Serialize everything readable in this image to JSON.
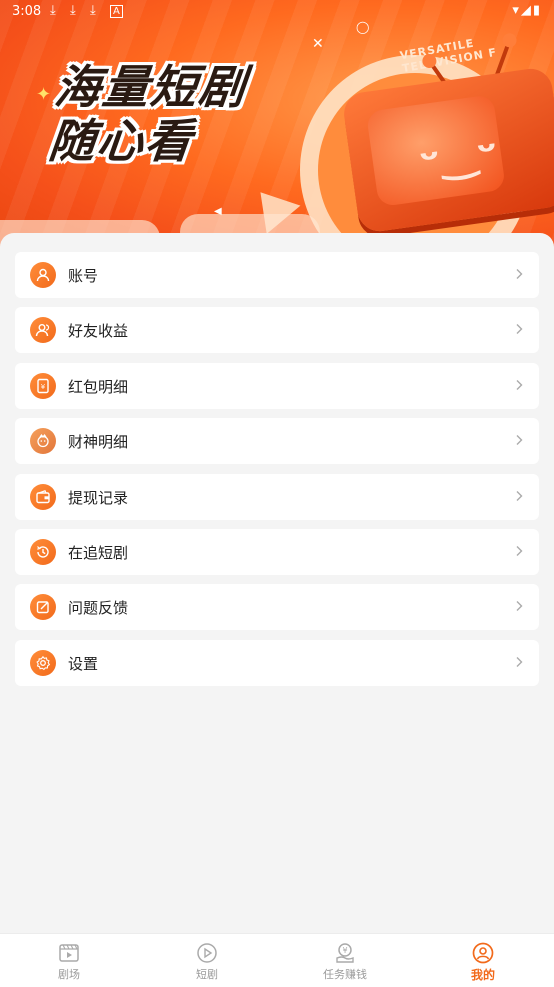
{
  "status_bar": {
    "time": "3:08"
  },
  "banner": {
    "slogan_line1": "海量短剧",
    "slogan_line2": "随心看",
    "ring_text": "VERSATILE TELEVISION F"
  },
  "menu": {
    "items": [
      {
        "label": "账号",
        "icon": "user-icon"
      },
      {
        "label": "好友收益",
        "icon": "friends-icon"
      },
      {
        "label": "红包明细",
        "icon": "red-envelope-icon"
      },
      {
        "label": "财神明细",
        "icon": "wealth-god-icon"
      },
      {
        "label": "提现记录",
        "icon": "wallet-icon"
      },
      {
        "label": "在追短剧",
        "icon": "history-icon"
      },
      {
        "label": "问题反馈",
        "icon": "feedback-icon"
      },
      {
        "label": "设置",
        "icon": "settings-icon"
      }
    ]
  },
  "bottom_nav": {
    "tabs": [
      {
        "label": "剧场",
        "icon": "theater-icon",
        "active": false
      },
      {
        "label": "短剧",
        "icon": "play-icon",
        "active": false
      },
      {
        "label": "任务赚钱",
        "icon": "coin-task-icon",
        "active": false
      },
      {
        "label": "我的",
        "icon": "profile-icon",
        "active": true
      }
    ]
  },
  "colors": {
    "accent": "#f26a1b",
    "background": "#f4f4f4"
  }
}
